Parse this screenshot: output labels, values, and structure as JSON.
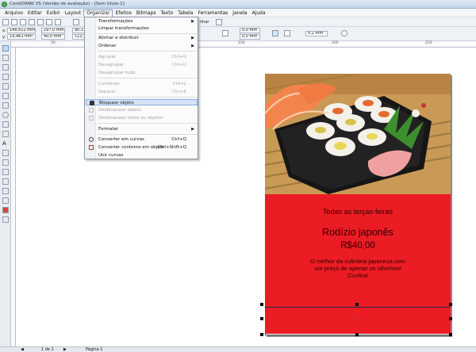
{
  "window": {
    "title": "CorelDRAW X5 (Versão de avaliação) - [Sem título-1]"
  },
  "menubar": {
    "items": [
      "Arquivo",
      "Editar",
      "Exibir",
      "Layout",
      "Organizar",
      "Efeitos",
      "Bitmaps",
      "Texto",
      "Tabela",
      "Ferramentas",
      "Janela",
      "Ajuda"
    ],
    "active": "Organizar"
  },
  "toolbar": {
    "x": "148,812 mm",
    "y": "19,461 mm",
    "width": "297,0 mm",
    "height": "40,0 mm",
    "scale_x": "90,1",
    "scale_y": "112,1",
    "dx": "0,0 mm",
    "dy": "0,0 mm",
    "outline_width": "0,2 mm",
    "zoom_label": "nhar"
  },
  "ruler": {
    "ticks": [
      "50",
      "100",
      "150",
      "200",
      "250"
    ]
  },
  "organizar_menu": {
    "items": [
      {
        "label": "Transformações",
        "shortcut": "",
        "submenu": true,
        "disabled": false
      },
      {
        "label": "Limpar transformações",
        "shortcut": "",
        "submenu": false,
        "disabled": false
      },
      {
        "label": "Alinhar e distribuir",
        "shortcut": "",
        "submenu": true,
        "disabled": false
      },
      {
        "label": "Ordenar",
        "shortcut": "",
        "submenu": true,
        "disabled": false
      },
      {
        "label": "Agrupar",
        "shortcut": "Ctrl+G",
        "submenu": false,
        "disabled": true
      },
      {
        "label": "Desagrupar",
        "shortcut": "Ctrl+U",
        "submenu": false,
        "disabled": true
      },
      {
        "label": "Desagrupar tudo",
        "shortcut": "",
        "submenu": false,
        "disabled": true
      },
      {
        "label": "Combinar",
        "shortcut": "Ctrl+L",
        "submenu": false,
        "disabled": true
      },
      {
        "label": "Separar",
        "shortcut": "Ctrl+K",
        "submenu": false,
        "disabled": true
      },
      {
        "label": "Bloquear objeto",
        "shortcut": "",
        "submenu": false,
        "disabled": false,
        "highlighted": true
      },
      {
        "label": "Desbloquear objeto",
        "shortcut": "",
        "submenu": false,
        "disabled": true
      },
      {
        "label": "Desbloquear todos os objetos",
        "shortcut": "",
        "submenu": false,
        "disabled": true
      },
      {
        "label": "Formatar",
        "shortcut": "",
        "submenu": true,
        "disabled": false
      },
      {
        "label": "Converter em curvas",
        "shortcut": "Ctrl+Q",
        "submenu": false,
        "disabled": false
      },
      {
        "label": "Converter contorno em objeto",
        "shortcut": "Ctrl+Shift+Q",
        "submenu": false,
        "disabled": false
      },
      {
        "label": "Unir curvas",
        "shortcut": "",
        "submenu": false,
        "disabled": false
      }
    ]
  },
  "ad": {
    "line1": "Todas as terças-feiras",
    "line2": "Rodízio japonês",
    "line3": "R$40,00",
    "body": "O melhor da culinária japonesa com um preço de apertar os olhinhos! Confira!"
  },
  "statusbar": {
    "page_count": "1 de 1",
    "page_tab": "Página 1"
  },
  "colors": {
    "ad_red": "#ec1c24",
    "highlight": "#d5e3f6"
  }
}
